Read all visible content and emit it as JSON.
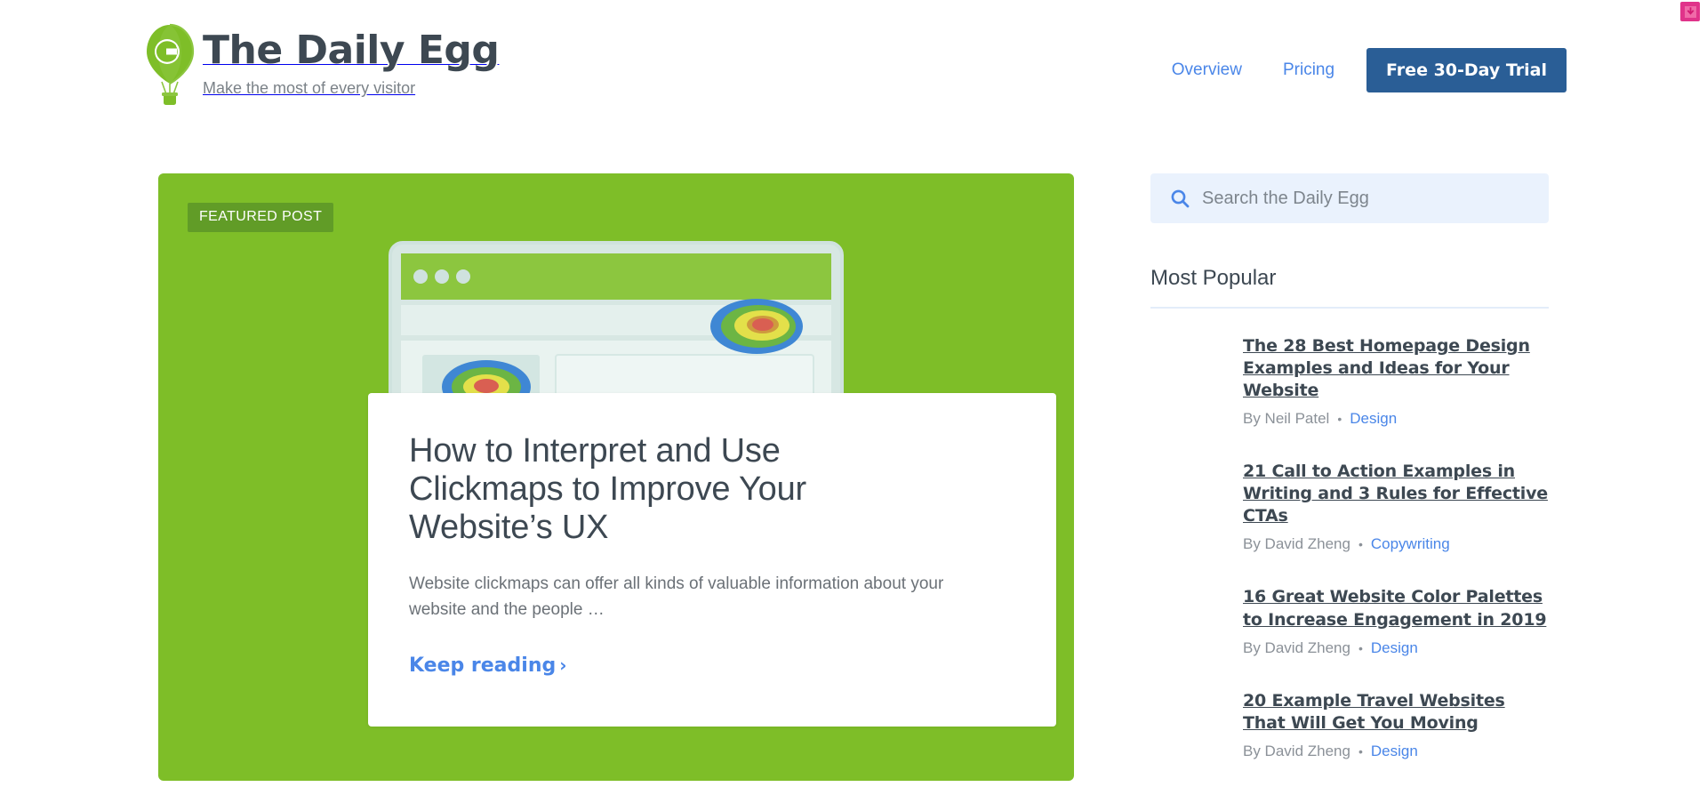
{
  "corner": {
    "icon": "download-badge-icon"
  },
  "brand": {
    "title": "The Daily Egg",
    "tagline": "Make the most of every visitor",
    "logo_icon": "hot-air-balloon-crazyegg-logo"
  },
  "nav": {
    "links": [
      {
        "label": "Overview",
        "name": "nav-link-overview"
      },
      {
        "label": "Pricing",
        "name": "nav-link-pricing"
      }
    ],
    "cta_label": "Free 30-Day Trial"
  },
  "hero": {
    "badge": "FEATURED POST",
    "title": "How to Interpret and Use Clickmaps to Improve Your Website’s UX",
    "excerpt": "Website clickmaps can offer all kinds of valuable information about your website and the people …",
    "read_more": "Keep reading",
    "chevron": "›",
    "background_color": "#7ebe28",
    "illustration": "browser-window-with-heatmap-illustration"
  },
  "sidebar": {
    "search": {
      "placeholder": "Search the Daily Egg",
      "value": "",
      "icon": "search-icon",
      "background_color": "#eaf2fd"
    },
    "popular_heading": "Most Popular",
    "posts": [
      {
        "title": "The 28 Best Homepage Design Examples and Ideas for Your Website",
        "author": "By Neil Patel",
        "separator": "•",
        "category": "Design"
      },
      {
        "title": "21 Call to Action Examples in Writing and 3 Rules for Effective CTAs",
        "author": "By David Zheng",
        "separator": "•",
        "category": "Copywriting"
      },
      {
        "title": "16 Great Website Color Palettes to Increase Engagement in 2019",
        "author": "By David Zheng",
        "separator": "•",
        "category": "Design"
      },
      {
        "title": "20 Example Travel Websites That Will Get You Moving",
        "author": "By David Zheng",
        "separator": "•",
        "category": "Design"
      }
    ]
  },
  "colors": {
    "brand_green": "#7ebe28",
    "link_blue": "#4a86e8",
    "cta_blue": "#2a5e96",
    "text_dark": "#3d4852",
    "text_muted": "#8b9198",
    "badge_pink": "#e0338a"
  }
}
